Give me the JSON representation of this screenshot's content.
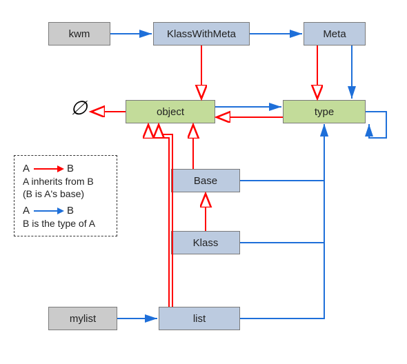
{
  "nodes": {
    "kwm": "kwm",
    "klasswithmeta": "KlassWithMeta",
    "meta": "Meta",
    "object": "object",
    "type": "type",
    "base": "Base",
    "klass": "Klass",
    "mylist": "mylist",
    "list": "list"
  },
  "empty_symbol": "∅",
  "legend": {
    "A": "A",
    "B": "B",
    "inherits_line1": "A inherits from B",
    "inherits_line2": "(B is A's base)",
    "type_line": "B is the type of A"
  },
  "colors": {
    "red": "#ff0000",
    "blue": "#1e6fd9",
    "open_head": "#ffffff"
  },
  "chart_data": {
    "type": "diagram",
    "title": "",
    "node_styles": {
      "instance": "grey",
      "class": "blue",
      "core": "green"
    },
    "nodes": [
      {
        "id": "kwm",
        "label": "kwm",
        "style": "instance"
      },
      {
        "id": "klasswithmeta",
        "label": "KlassWithMeta",
        "style": "class"
      },
      {
        "id": "meta",
        "label": "Meta",
        "style": "class"
      },
      {
        "id": "object",
        "label": "object",
        "style": "core"
      },
      {
        "id": "type",
        "label": "type",
        "style": "core"
      },
      {
        "id": "base",
        "label": "Base",
        "style": "class"
      },
      {
        "id": "klass",
        "label": "Klass",
        "style": "class"
      },
      {
        "id": "list",
        "label": "list",
        "style": "class"
      },
      {
        "id": "mylist",
        "label": "mylist",
        "style": "instance"
      },
      {
        "id": "empty",
        "label": "∅",
        "style": "symbol"
      }
    ],
    "edges": [
      {
        "from": "kwm",
        "to": "klasswithmeta",
        "relation": "type_of"
      },
      {
        "from": "klasswithmeta",
        "to": "meta",
        "relation": "type_of"
      },
      {
        "from": "klasswithmeta",
        "to": "object",
        "relation": "inherits"
      },
      {
        "from": "meta",
        "to": "type",
        "relation": "type_of"
      },
      {
        "from": "meta",
        "to": "type",
        "relation": "inherits"
      },
      {
        "from": "object",
        "to": "type",
        "relation": "type_of"
      },
      {
        "from": "object",
        "to": "empty",
        "relation": "inherits"
      },
      {
        "from": "type",
        "to": "type",
        "relation": "type_of"
      },
      {
        "from": "type",
        "to": "object",
        "relation": "inherits"
      },
      {
        "from": "base",
        "to": "object",
        "relation": "inherits"
      },
      {
        "from": "base",
        "to": "type",
        "relation": "type_of"
      },
      {
        "from": "klass",
        "to": "base",
        "relation": "inherits"
      },
      {
        "from": "klass",
        "to": "type",
        "relation": "type_of"
      },
      {
        "from": "list",
        "to": "object",
        "relation": "inherits"
      },
      {
        "from": "list",
        "to": "type",
        "relation": "type_of"
      },
      {
        "from": "mylist",
        "to": "list",
        "relation": "type_of"
      }
    ],
    "legend": [
      {
        "relation": "inherits",
        "color": "red",
        "arrowhead": "open",
        "text": "A inherits from B (B is A's base)"
      },
      {
        "relation": "type_of",
        "color": "blue",
        "arrowhead": "closed",
        "text": "B is the type of A"
      }
    ]
  }
}
